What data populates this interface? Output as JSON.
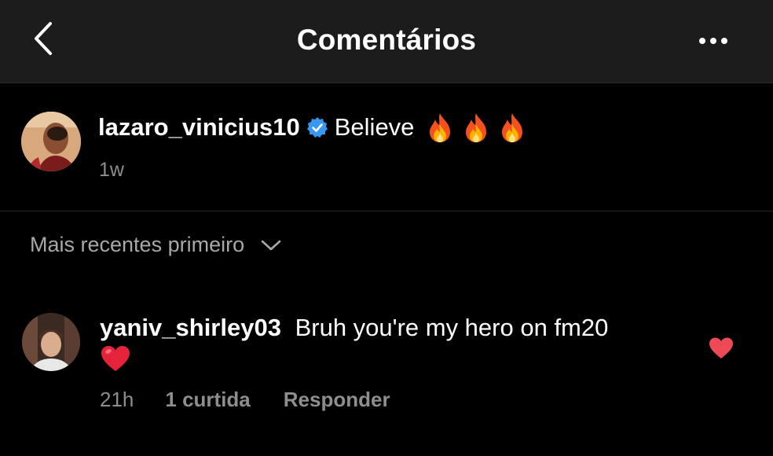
{
  "header": {
    "title": "Comentários",
    "back_icon": "chevron-left-icon",
    "more_icon": "more-horizontal-icon"
  },
  "caption": {
    "username": "lazaro_vinicius10",
    "verified_icon": "verified-badge-icon",
    "text": "Believe",
    "emoji_icons": [
      "fire-emoji",
      "fire-emoji",
      "fire-emoji"
    ],
    "time": "1w"
  },
  "sort": {
    "label": "Mais recentes primeiro",
    "icon": "chevron-down-icon"
  },
  "comments": [
    {
      "username": "yaniv_shirley03",
      "text": "Bruh you're my hero on fm20",
      "emoji_icon": "red-heart-emoji",
      "time": "21h",
      "likes": "1 curtida",
      "reply_label": "Responder",
      "liked": true,
      "like_icon": "heart-filled-icon"
    }
  ],
  "colors": {
    "background": "#000000",
    "header_background": "#1c1c1c",
    "verified_blue": "#3897f0",
    "like_red": "#ed4956",
    "secondary_text": "#8e8e8e"
  }
}
